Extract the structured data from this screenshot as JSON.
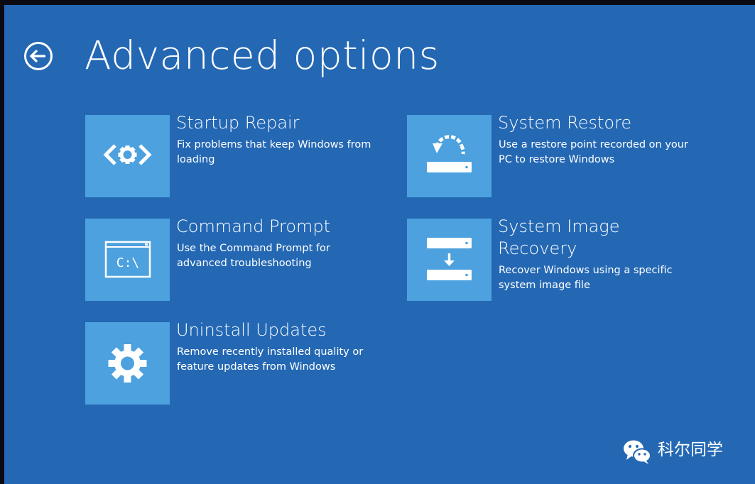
{
  "page": {
    "title": "Advanced options",
    "background_color": "#2468b4",
    "tile_color": "#4ca1de"
  },
  "back": {
    "icon": "back-arrow-icon"
  },
  "options": [
    {
      "title": "Startup Repair",
      "description": "Fix problems that keep Windows from loading",
      "icon": "startup-repair-icon"
    },
    {
      "title": "System Restore",
      "description": "Use a restore point recorded on your PC to restore Windows",
      "icon": "system-restore-icon"
    },
    {
      "title": "Command Prompt",
      "description": "Use the Command Prompt for advanced troubleshooting",
      "icon": "command-prompt-icon",
      "icon_text": "C:\\"
    },
    {
      "title": "System Image Recovery",
      "description": "Recover Windows using a specific system image file",
      "icon": "system-image-recovery-icon"
    },
    {
      "title": "Uninstall Updates",
      "description": "Remove recently installed quality or feature updates from Windows",
      "icon": "gear-icon"
    }
  ],
  "watermark": {
    "text": "科尔同学",
    "icon": "wechat-icon"
  }
}
